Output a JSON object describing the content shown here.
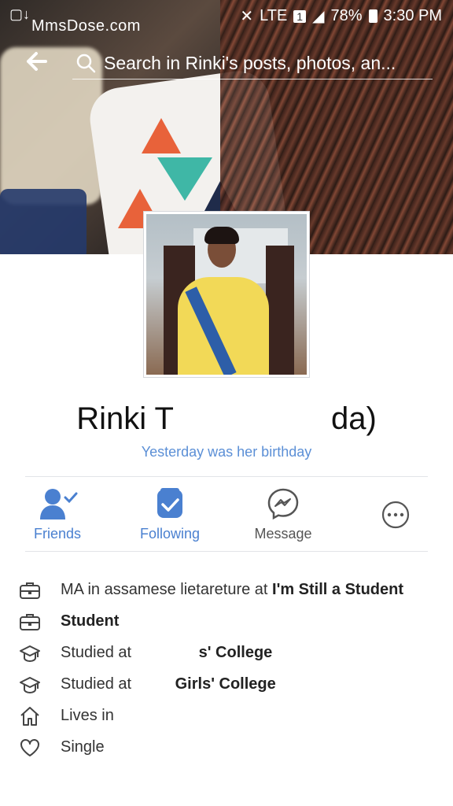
{
  "status_bar": {
    "time": "3:30 PM",
    "battery": "78%",
    "network": "LTE",
    "sim": "1"
  },
  "watermark": "MmsDose.com",
  "search": {
    "placeholder": "Search in Rinki's posts, photos, an..."
  },
  "profile": {
    "name_first": "Rinki T",
    "name_end": "da)",
    "birthday_note": "Yesterday was her birthday"
  },
  "actions": [
    {
      "label": "Friends",
      "icon": "friends-check-icon"
    },
    {
      "label": "Following",
      "icon": "following-check-icon"
    },
    {
      "label": "Message",
      "icon": "messenger-icon"
    },
    {
      "label": "",
      "icon": "more-icon"
    }
  ],
  "about": [
    {
      "icon": "briefcase-icon",
      "text": "MA in assamese lietareture at ",
      "bold": "I'm Still a Student"
    },
    {
      "icon": "briefcase-icon",
      "text": "",
      "bold": "Student"
    },
    {
      "icon": "graduation-cap-icon",
      "text": "Studied at ",
      "bold": "s' College"
    },
    {
      "icon": "graduation-cap-icon",
      "text": "Studied at ",
      "bold": "Girls' College"
    },
    {
      "icon": "home-icon",
      "text": "Lives in ",
      "bold": ""
    },
    {
      "icon": "heart-icon",
      "text": "Single",
      "bold": ""
    }
  ],
  "colors": {
    "accent": "#4a80d0",
    "birthday": "#5b8fd6",
    "text": "#333333"
  }
}
